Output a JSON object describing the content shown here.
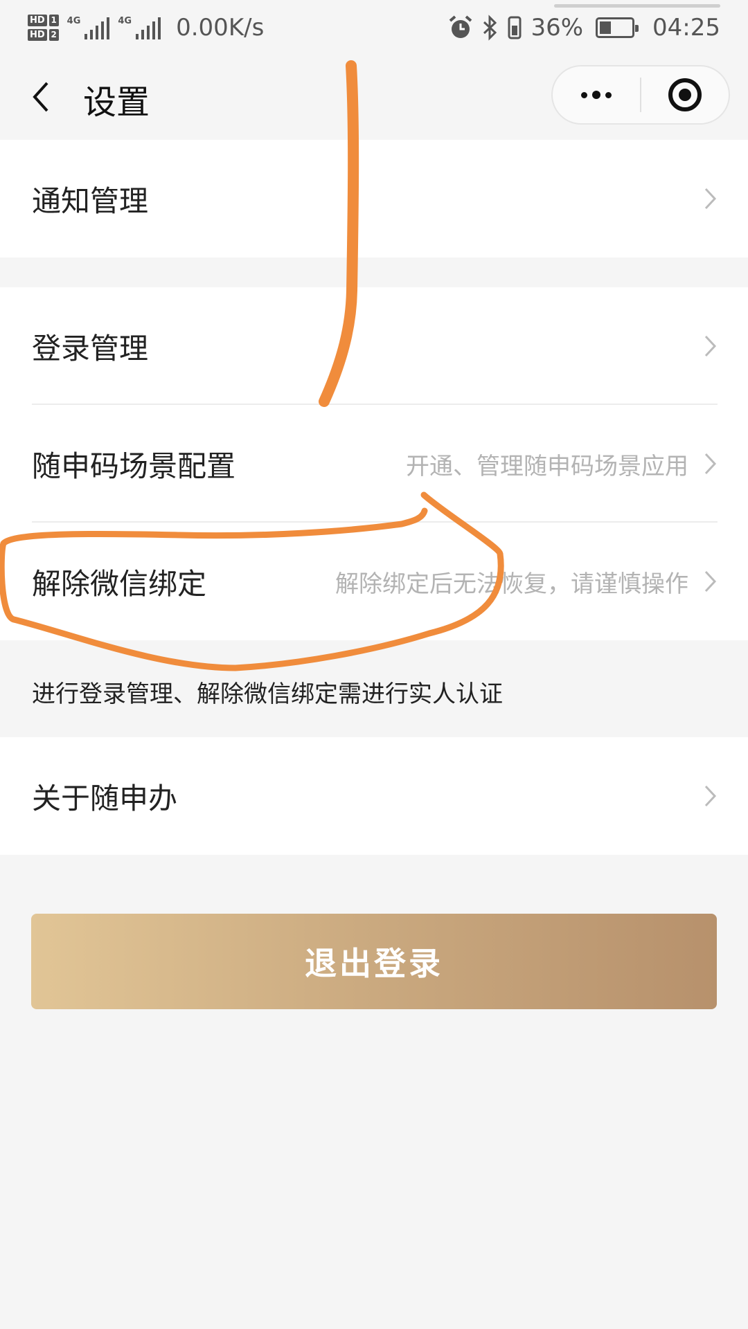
{
  "status_bar": {
    "hd1": "HD",
    "hd1_num": "1",
    "hd2": "HD",
    "hd2_num": "2",
    "net1": "4G",
    "net2": "4G",
    "speed": "0.00K/s",
    "battery": "36%",
    "battery_level": 0.36,
    "time": "04:25",
    "icons": [
      "alarm-icon",
      "bluetooth-icon",
      "vibrate-icon",
      "battery-icon"
    ]
  },
  "nav": {
    "title": "设置",
    "back_icon": "chevron-left-icon",
    "more_icon": "more-dots-icon",
    "close_icon": "target-circle-icon"
  },
  "sections": {
    "notify": {
      "label": "通知管理"
    },
    "login": {
      "label": "登录管理"
    },
    "scene": {
      "label": "随申码场景配置",
      "desc": "开通、管理随申码场景应用"
    },
    "unbind": {
      "label": "解除微信绑定",
      "desc": "解除绑定后无法恢复，请谨慎操作"
    },
    "about": {
      "label": "关于随申办"
    }
  },
  "note": "进行登录管理、解除微信绑定需进行实人认证",
  "logout_label": "退出登录",
  "colors": {
    "background": "#f5f5f5",
    "button_gradient_start": "#e1c596",
    "button_gradient_end": "#b7916c",
    "annotation": "#f08c3c"
  }
}
